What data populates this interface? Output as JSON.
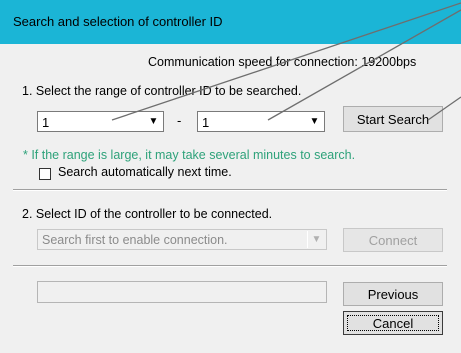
{
  "window": {
    "title": "Search and selection of controller ID"
  },
  "header": {
    "comm_speed": "Communication speed for connection: 19200bps"
  },
  "step1": {
    "label": "1. Select the range of controller ID to be searched.",
    "from_value": "1",
    "separator": "-",
    "to_value": "1",
    "start_button": "Start Search",
    "note": "* If the range is large, it may take several minutes to search.",
    "auto_search_label": "Search automatically next time.",
    "auto_search_checked": false
  },
  "step2": {
    "label": "2. Select ID of the controller to be connected.",
    "select_placeholder": "Search first to enable connection.",
    "connect_button": "Connect"
  },
  "footer": {
    "status_text": "",
    "previous_button": "Previous",
    "cancel_button": "Cancel"
  },
  "icons": {
    "dropdown": "chevron-down-icon"
  },
  "colors": {
    "titlebar": "#1bb5d6",
    "note": "#2ea27a",
    "callout_line": "#6e6e6e"
  }
}
